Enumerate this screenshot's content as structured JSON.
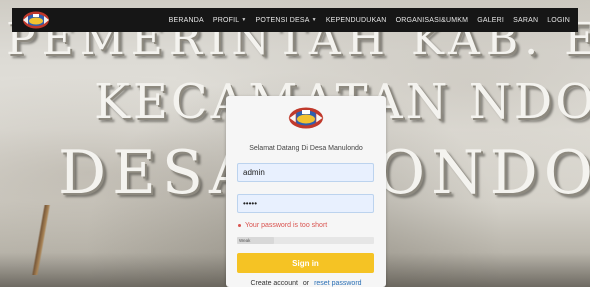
{
  "background": {
    "line1": "PEMERINTAH  KAB. ENDE",
    "line2": "KECAMATAN  NDONA",
    "line3": "DESA M  ONDO"
  },
  "nav": {
    "logo_icon": "regency-emblem-icon",
    "items": [
      {
        "label": "BERANDA",
        "dropdown": false
      },
      {
        "label": "PROFIL",
        "dropdown": true
      },
      {
        "label": "POTENSI DESA",
        "dropdown": true
      },
      {
        "label": "KEPENDUDUKAN",
        "dropdown": false
      },
      {
        "label": "ORGANISASI&UMKM",
        "dropdown": false
      },
      {
        "label": "GALERI",
        "dropdown": false
      },
      {
        "label": "SARAN",
        "dropdown": false
      },
      {
        "label": "LOGIN",
        "dropdown": false
      }
    ],
    "caret": "▼"
  },
  "login": {
    "logo_icon": "regency-emblem-icon",
    "welcome": "Selamat Datang Di Desa Manulondo",
    "username_value": "admin",
    "password_value": "•••••",
    "error": "Your password is too short",
    "strength_label": "Weak",
    "strength_level": 0.27,
    "signin_label": "Sign in",
    "create_account": "Create account",
    "or": "or",
    "reset_password": "reset password"
  },
  "colors": {
    "nav_bg": "#161616",
    "button": "#f5c324",
    "error": "#d9534f",
    "input_bg": "#e8f0fe",
    "link": "#2a6fb5"
  }
}
